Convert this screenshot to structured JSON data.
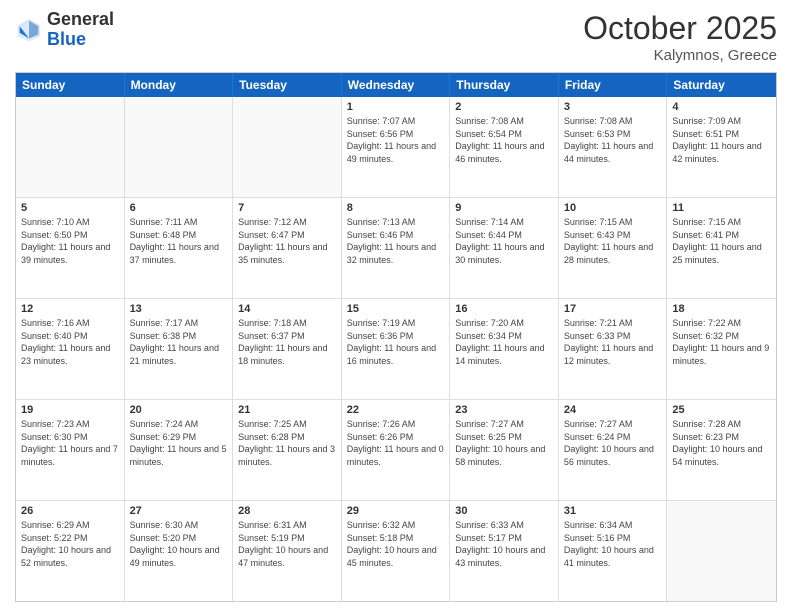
{
  "header": {
    "logo_general": "General",
    "logo_blue": "Blue",
    "month": "October 2025",
    "location": "Kalymnos, Greece"
  },
  "days_of_week": [
    "Sunday",
    "Monday",
    "Tuesday",
    "Wednesday",
    "Thursday",
    "Friday",
    "Saturday"
  ],
  "weeks": [
    [
      {
        "day": "",
        "info": ""
      },
      {
        "day": "",
        "info": ""
      },
      {
        "day": "",
        "info": ""
      },
      {
        "day": "1",
        "info": "Sunrise: 7:07 AM\nSunset: 6:56 PM\nDaylight: 11 hours and 49 minutes."
      },
      {
        "day": "2",
        "info": "Sunrise: 7:08 AM\nSunset: 6:54 PM\nDaylight: 11 hours and 46 minutes."
      },
      {
        "day": "3",
        "info": "Sunrise: 7:08 AM\nSunset: 6:53 PM\nDaylight: 11 hours and 44 minutes."
      },
      {
        "day": "4",
        "info": "Sunrise: 7:09 AM\nSunset: 6:51 PM\nDaylight: 11 hours and 42 minutes."
      }
    ],
    [
      {
        "day": "5",
        "info": "Sunrise: 7:10 AM\nSunset: 6:50 PM\nDaylight: 11 hours and 39 minutes."
      },
      {
        "day": "6",
        "info": "Sunrise: 7:11 AM\nSunset: 6:48 PM\nDaylight: 11 hours and 37 minutes."
      },
      {
        "day": "7",
        "info": "Sunrise: 7:12 AM\nSunset: 6:47 PM\nDaylight: 11 hours and 35 minutes."
      },
      {
        "day": "8",
        "info": "Sunrise: 7:13 AM\nSunset: 6:46 PM\nDaylight: 11 hours and 32 minutes."
      },
      {
        "day": "9",
        "info": "Sunrise: 7:14 AM\nSunset: 6:44 PM\nDaylight: 11 hours and 30 minutes."
      },
      {
        "day": "10",
        "info": "Sunrise: 7:15 AM\nSunset: 6:43 PM\nDaylight: 11 hours and 28 minutes."
      },
      {
        "day": "11",
        "info": "Sunrise: 7:15 AM\nSunset: 6:41 PM\nDaylight: 11 hours and 25 minutes."
      }
    ],
    [
      {
        "day": "12",
        "info": "Sunrise: 7:16 AM\nSunset: 6:40 PM\nDaylight: 11 hours and 23 minutes."
      },
      {
        "day": "13",
        "info": "Sunrise: 7:17 AM\nSunset: 6:38 PM\nDaylight: 11 hours and 21 minutes."
      },
      {
        "day": "14",
        "info": "Sunrise: 7:18 AM\nSunset: 6:37 PM\nDaylight: 11 hours and 18 minutes."
      },
      {
        "day": "15",
        "info": "Sunrise: 7:19 AM\nSunset: 6:36 PM\nDaylight: 11 hours and 16 minutes."
      },
      {
        "day": "16",
        "info": "Sunrise: 7:20 AM\nSunset: 6:34 PM\nDaylight: 11 hours and 14 minutes."
      },
      {
        "day": "17",
        "info": "Sunrise: 7:21 AM\nSunset: 6:33 PM\nDaylight: 11 hours and 12 minutes."
      },
      {
        "day": "18",
        "info": "Sunrise: 7:22 AM\nSunset: 6:32 PM\nDaylight: 11 hours and 9 minutes."
      }
    ],
    [
      {
        "day": "19",
        "info": "Sunrise: 7:23 AM\nSunset: 6:30 PM\nDaylight: 11 hours and 7 minutes."
      },
      {
        "day": "20",
        "info": "Sunrise: 7:24 AM\nSunset: 6:29 PM\nDaylight: 11 hours and 5 minutes."
      },
      {
        "day": "21",
        "info": "Sunrise: 7:25 AM\nSunset: 6:28 PM\nDaylight: 11 hours and 3 minutes."
      },
      {
        "day": "22",
        "info": "Sunrise: 7:26 AM\nSunset: 6:26 PM\nDaylight: 11 hours and 0 minutes."
      },
      {
        "day": "23",
        "info": "Sunrise: 7:27 AM\nSunset: 6:25 PM\nDaylight: 10 hours and 58 minutes."
      },
      {
        "day": "24",
        "info": "Sunrise: 7:27 AM\nSunset: 6:24 PM\nDaylight: 10 hours and 56 minutes."
      },
      {
        "day": "25",
        "info": "Sunrise: 7:28 AM\nSunset: 6:23 PM\nDaylight: 10 hours and 54 minutes."
      }
    ],
    [
      {
        "day": "26",
        "info": "Sunrise: 6:29 AM\nSunset: 5:22 PM\nDaylight: 10 hours and 52 minutes."
      },
      {
        "day": "27",
        "info": "Sunrise: 6:30 AM\nSunset: 5:20 PM\nDaylight: 10 hours and 49 minutes."
      },
      {
        "day": "28",
        "info": "Sunrise: 6:31 AM\nSunset: 5:19 PM\nDaylight: 10 hours and 47 minutes."
      },
      {
        "day": "29",
        "info": "Sunrise: 6:32 AM\nSunset: 5:18 PM\nDaylight: 10 hours and 45 minutes."
      },
      {
        "day": "30",
        "info": "Sunrise: 6:33 AM\nSunset: 5:17 PM\nDaylight: 10 hours and 43 minutes."
      },
      {
        "day": "31",
        "info": "Sunrise: 6:34 AM\nSunset: 5:16 PM\nDaylight: 10 hours and 41 minutes."
      },
      {
        "day": "",
        "info": ""
      }
    ]
  ]
}
